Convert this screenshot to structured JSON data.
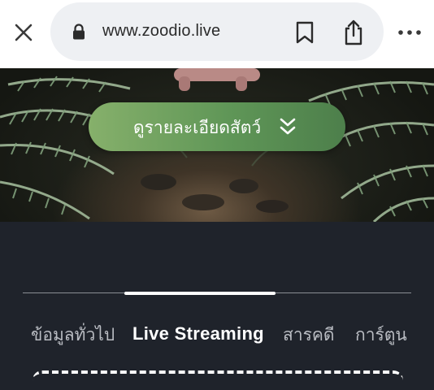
{
  "browser": {
    "url": "www.zoodio.live",
    "icons": [
      "close-icon",
      "lock-icon",
      "bookmark-icon",
      "share-icon",
      "more-icon"
    ]
  },
  "hero": {
    "cta_label": "ดูรายละเอียดสัตว์",
    "cta_icon": "double-chevron-down-icon",
    "cta_color": "#6a9e5c"
  },
  "tabs": {
    "items": [
      {
        "label": "ข้อมูลทั่วไป",
        "active": false
      },
      {
        "label": "Live Streaming",
        "active": true
      },
      {
        "label": "สารคดี",
        "active": false
      },
      {
        "label": "การ์ตูน",
        "active": false
      }
    ]
  },
  "colors": {
    "panel_bg": "#1f232b",
    "tab_inactive": "#b9bcc2",
    "tab_active": "#ffffff"
  }
}
